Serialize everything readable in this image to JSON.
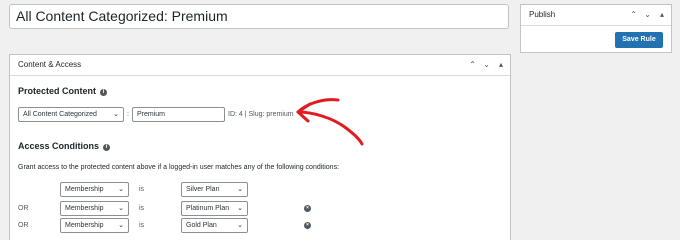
{
  "post": {
    "title": "All Content Categorized: Premium"
  },
  "publish": {
    "title": "Publish",
    "save_label": "Save Rule"
  },
  "panel": {
    "title": "Content & Access",
    "protected": {
      "heading": "Protected Content",
      "type_select": "All Content Categorized",
      "separator": ":",
      "term_value": "Premium",
      "meta": "ID: 4 | Slug: premium"
    },
    "access": {
      "heading": "Access Conditions",
      "description": "Grant access to the protected content above if a logged-in user matches any of the following conditions:",
      "rows": [
        {
          "prefix": "",
          "type": "Membership",
          "op": "is",
          "value": "Silver Plan",
          "removable": false
        },
        {
          "prefix": "OR",
          "type": "Membership",
          "op": "is",
          "value": "Platinum Plan",
          "removable": true
        },
        {
          "prefix": "OR",
          "type": "Membership",
          "op": "is",
          "value": "Gold Plan",
          "removable": true
        }
      ]
    }
  },
  "icons": {
    "chevron_up": "▲",
    "chevron_down": "▼",
    "collapse": "▴",
    "info": "i",
    "remove": "×",
    "caret": "⌄"
  },
  "colors": {
    "primary": "#2271b1",
    "annotation": "#e11b22"
  }
}
